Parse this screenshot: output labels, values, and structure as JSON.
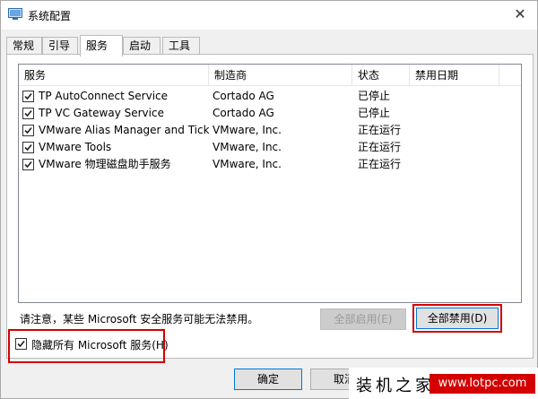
{
  "window": {
    "title": "系统配置",
    "close_glyph": "✕"
  },
  "tabs": [
    {
      "label": "常规"
    },
    {
      "label": "引导"
    },
    {
      "label": "服务",
      "active": true
    },
    {
      "label": "启动"
    },
    {
      "label": "工具"
    }
  ],
  "list": {
    "columns": [
      "服务",
      "制造商",
      "状态",
      "禁用日期"
    ],
    "rows": [
      {
        "checked": true,
        "service": "TP AutoConnect Service",
        "maker": "Cortado AG",
        "status": "已停止",
        "date": ""
      },
      {
        "checked": true,
        "service": "TP VC Gateway Service",
        "maker": "Cortado AG",
        "status": "已停止",
        "date": ""
      },
      {
        "checked": true,
        "service": "VMware Alias Manager and Tick...",
        "maker": "VMware, Inc.",
        "status": "正在运行",
        "date": ""
      },
      {
        "checked": true,
        "service": "VMware Tools",
        "maker": "VMware, Inc.",
        "status": "正在运行",
        "date": ""
      },
      {
        "checked": true,
        "service": "VMware 物理磁盘助手服务",
        "maker": "VMware, Inc.",
        "status": "正在运行",
        "date": ""
      }
    ]
  },
  "notice": "请注意，某些 Microsoft 安全服务可能无法禁用。",
  "buttons": {
    "enable_all": "全部启用(E)",
    "disable_all": "全部禁用(D)",
    "ok": "确定",
    "cancel": "取消"
  },
  "hide_ms": {
    "checked": true,
    "label": "隐藏所有 Microsoft 服务(H)"
  },
  "watermark": {
    "cn": "装机之家",
    "url": "www.lotpc.com"
  },
  "colors": {
    "highlight": "#d40000",
    "focus": "#0078d7"
  }
}
